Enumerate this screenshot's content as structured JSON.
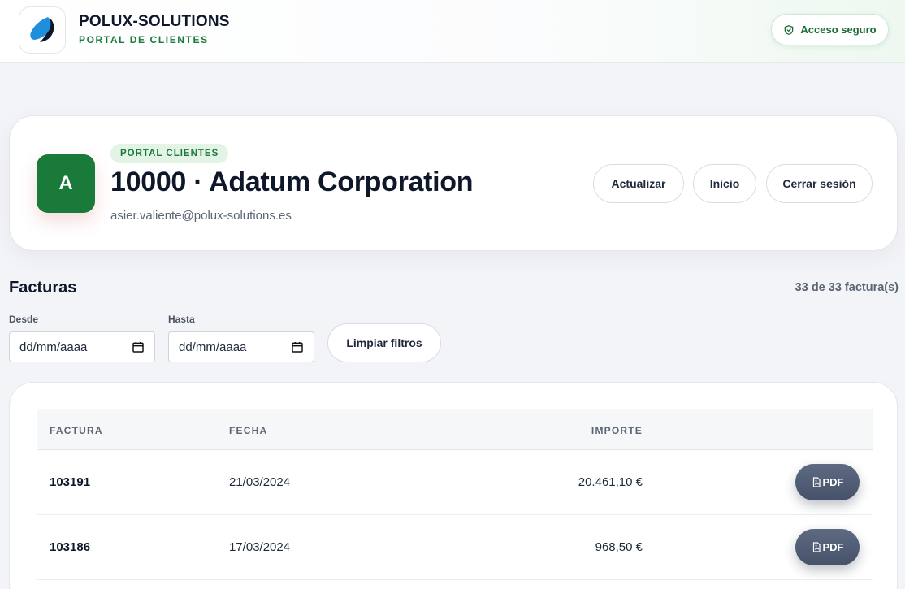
{
  "header": {
    "brand_name": "POLUX-SOLUTIONS",
    "brand_subtitle": "PORTAL DE CLIENTES",
    "secure_label": "Acceso seguro",
    "logo_icon": "leaf-logo-icon",
    "secure_icon": "shield-icon"
  },
  "profile": {
    "avatar_letter": "A",
    "tag": "PORTAL CLIENTES",
    "title": "10000 · Adatum Corporation",
    "email": "asier.valiente@polux-solutions.es",
    "buttons": {
      "refresh": "Actualizar",
      "home": "Inicio",
      "logout": "Cerrar sesión"
    }
  },
  "invoices": {
    "title": "Facturas",
    "count": "33 de 33 factura(s)",
    "filters": {
      "from_label": "Desde",
      "from_value": "dd/mm/aaaa",
      "to_label": "Hasta",
      "to_value": "dd/mm/aaaa",
      "clear_label": "Limpiar filtros",
      "calendar_icon": "calendar-icon"
    },
    "columns": [
      "FACTURA",
      "FECHA",
      "IMPORTE"
    ],
    "rows": [
      {
        "number": "103191",
        "date": "21/03/2024",
        "amount": "20.461,10 €",
        "pdf": "PDF"
      },
      {
        "number": "103186",
        "date": "17/03/2024",
        "amount": "968,50 €",
        "pdf": "PDF"
      }
    ]
  },
  "colors": {
    "brand_green": "#1a7a3a",
    "tag_bg": "#e3f4e7",
    "pdf_button": "#536077",
    "text_dark": "#0f172a",
    "text_muted": "#5b6575"
  }
}
